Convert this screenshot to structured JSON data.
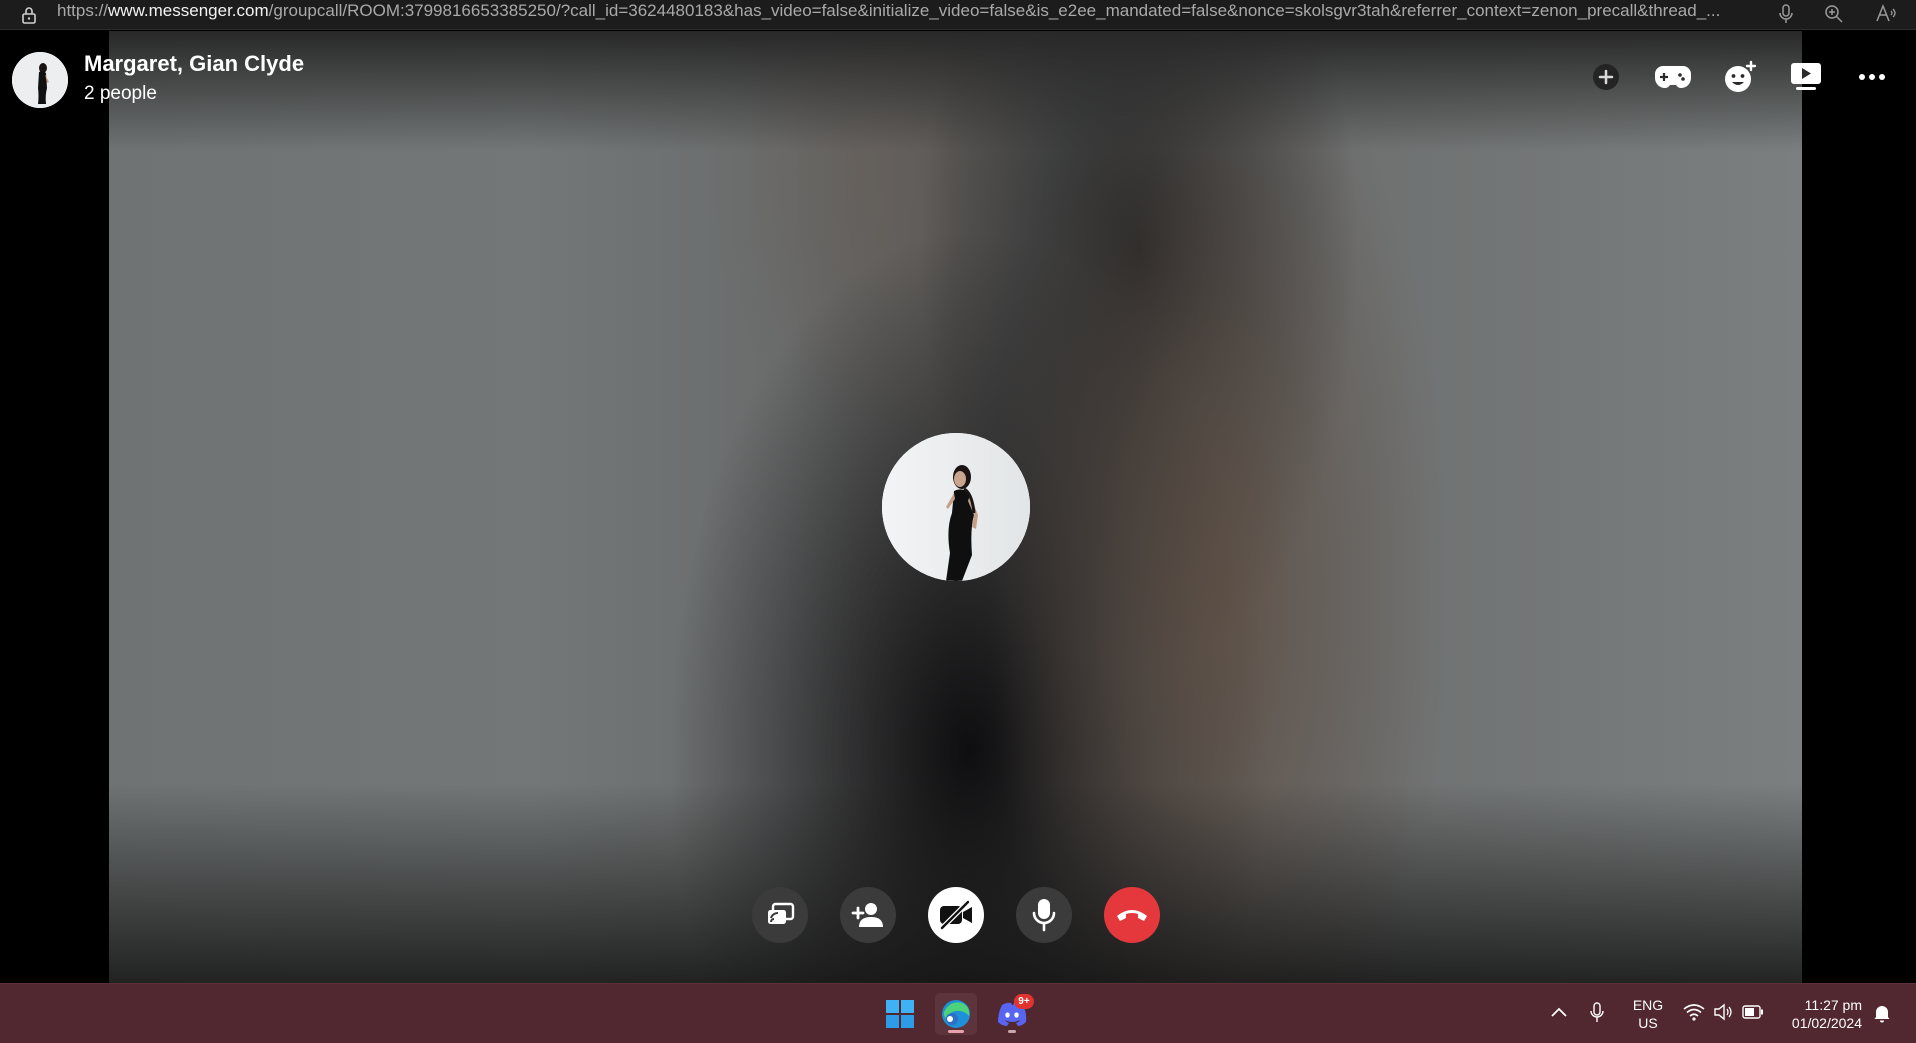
{
  "browser": {
    "url_prefix": "https://",
    "url_domain": "www.messenger.com",
    "url_path": "/groupcall/ROOM:3799816653385250/?call_id=3624480183&has_video=false&initialize_video=false&is_e2ee_mandated=false&nonce=skolsgvr3tah&referrer_context=zenon_precall&thread_...",
    "icons": [
      "lock-icon",
      "microphone-icon",
      "zoom-icon",
      "read-aloud-icon"
    ]
  },
  "call": {
    "title": "Margaret, Gian Clyde",
    "subtitle": "2 people",
    "header_actions": [
      "add-icon",
      "gamepad-icon",
      "effects-icon",
      "watch-together-icon",
      "more-icon"
    ],
    "controls": [
      {
        "name": "share-screen",
        "icon": "share-screen-icon"
      },
      {
        "name": "add-people",
        "icon": "add-person-icon"
      },
      {
        "name": "camera-off",
        "icon": "camera-off-icon"
      },
      {
        "name": "microphone",
        "icon": "microphone-icon"
      },
      {
        "name": "end-call",
        "icon": "hang-up-icon"
      }
    ],
    "colors": {
      "end_call": "#e4383c",
      "control_bg": "#3b3b3b",
      "camera_active": "#ffffff"
    }
  },
  "taskbar": {
    "apps": [
      "windows-start-icon",
      "edge-icon",
      "discord-icon"
    ],
    "discord_badge": "9+",
    "language": "ENG",
    "region": "US",
    "time": "11:27 pm",
    "date": "01/02/2024",
    "background": "#512730"
  }
}
